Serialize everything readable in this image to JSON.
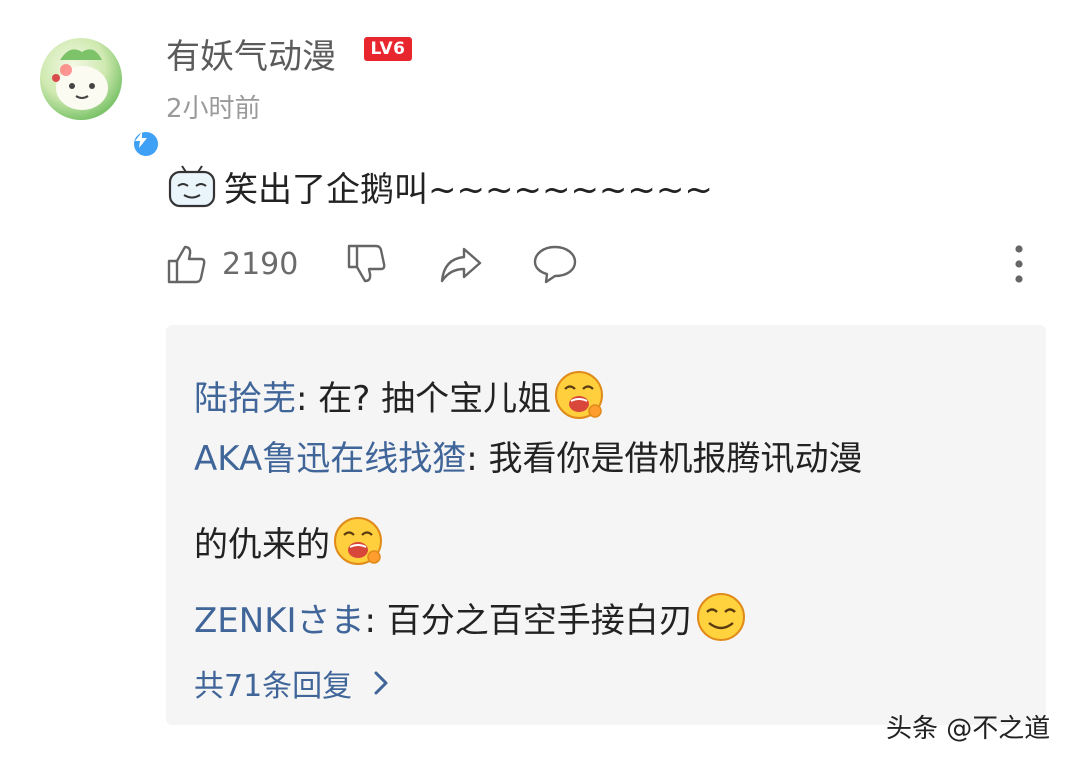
{
  "comment": {
    "username": "有妖气动漫",
    "level_badge": "LV6",
    "time": "2小时前",
    "text": "笑出了企鹅叫~~~~~~~~~~",
    "emoji_icon": "tv-smirk-emoji"
  },
  "actions": {
    "like_count": "2190",
    "icons": [
      "thumbs-up-icon",
      "thumbs-down-icon",
      "share-arrow-icon",
      "comment-bubble-icon",
      "more-vertical-icon"
    ]
  },
  "replies": [
    {
      "name": "陆拾芜",
      "text": ": 在? 抽个宝儿姐",
      "emoji": "greedy-face-emoji"
    },
    {
      "name": "AKA鲁迅在线找猹",
      "text": ": 我看你是借机报腾讯动漫",
      "text_cont": "的仇来的",
      "emoji": "greedy-face-emoji"
    },
    {
      "name": "ZENKIさま",
      "text": ": 百分之百空手接白刃",
      "emoji": "smug-smile-emoji"
    }
  ],
  "more_replies_label": "共71条回复",
  "watermark": "头条 @不之道",
  "colors": {
    "name_blue": "#406599",
    "badge_red": "#e8262d",
    "verify_blue": "#3ea1f5"
  }
}
